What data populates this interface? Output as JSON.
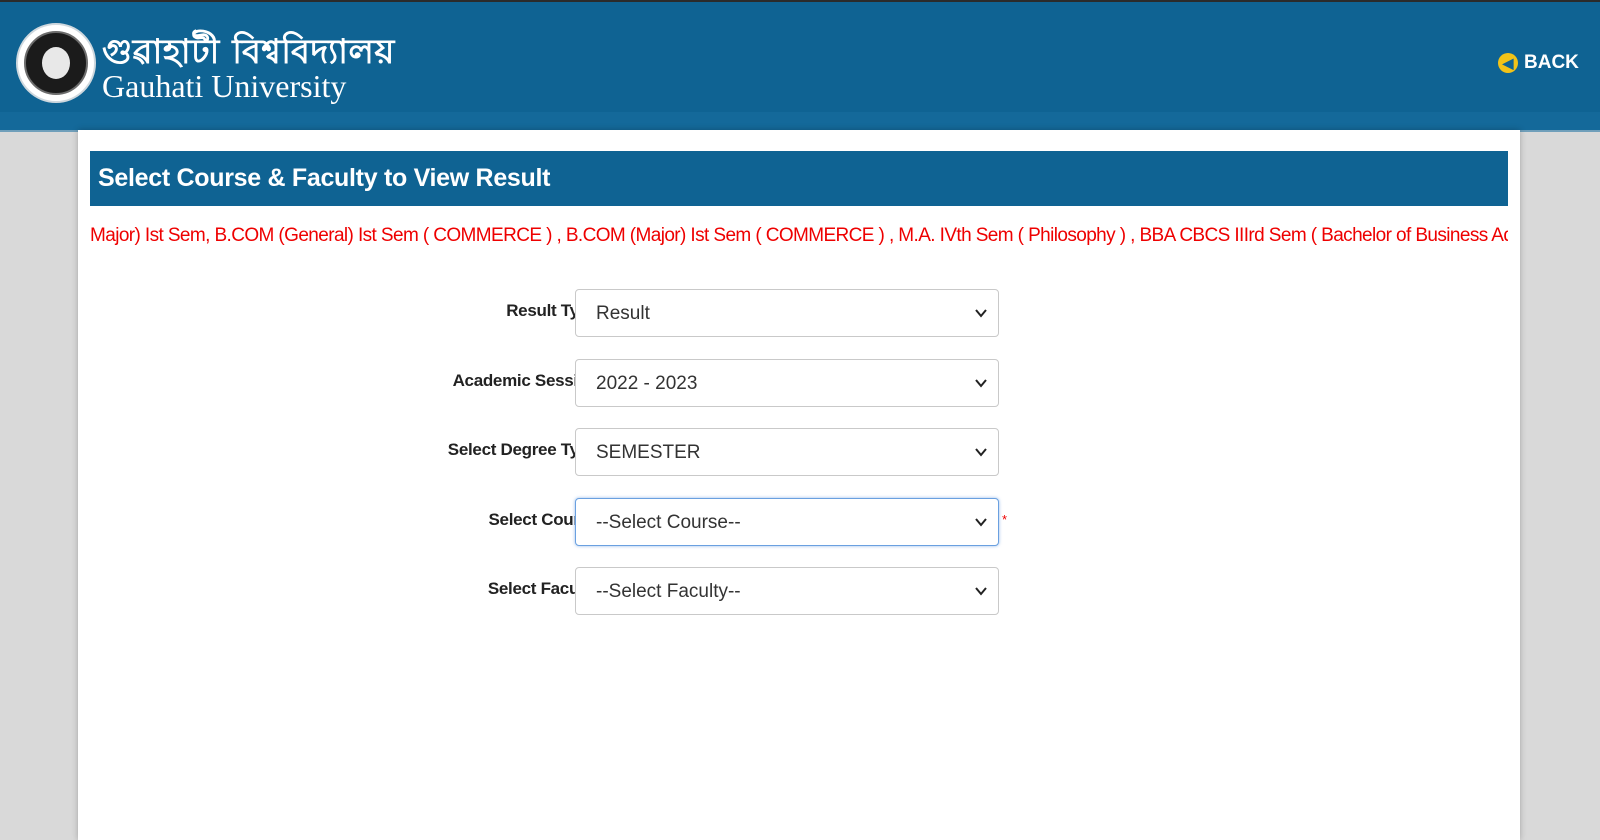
{
  "header": {
    "title_bengali": "গুৱাহাটী বিশ্ববিদ্যালয়",
    "title_english": "Gauhati University",
    "back_label": "BACK",
    "colors": {
      "header_bg": "#0f6393",
      "back_icon": "#f2c318"
    }
  },
  "panel": {
    "title": "Select Course & Faculty to View Result",
    "announcement": "Major) Ist Sem, B.COM (General) Ist Sem ( COMMERCE ) , B.COM (Major) Ist Sem ( COMMERCE ) , M.A. IVth Sem ( Philosophy ) , BBA CBCS IIIrd Sem ( Bachelor of Business Administration ) , M.A. I"
  },
  "form": {
    "result_type": {
      "label": "Result Type",
      "value": "Result"
    },
    "academic_session": {
      "label": "Academic Session",
      "value": "2022 - 2023"
    },
    "degree_type": {
      "label": "Select Degree Type",
      "value": "SEMESTER"
    },
    "course": {
      "label": "Select Course",
      "value": "--Select Course--",
      "required_mark": "*"
    },
    "faculty": {
      "label": "Select Faculty",
      "value": "--Select Faculty--"
    }
  },
  "icons": {
    "back": "arrow-left-circle-icon",
    "dropdown": "chevron-down-icon",
    "logo": "university-seal-logo"
  }
}
